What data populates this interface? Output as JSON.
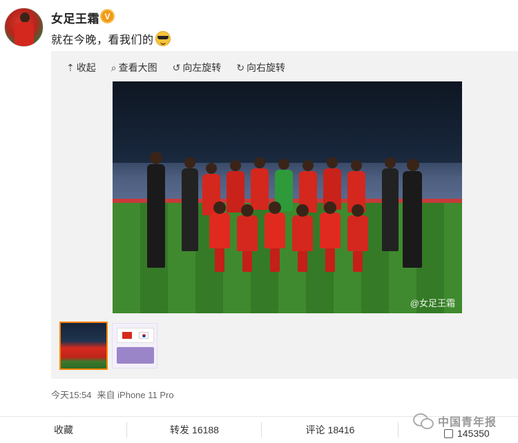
{
  "user": {
    "name": "女足王霜",
    "verified_badge": "V"
  },
  "post": {
    "text": "就在今晚，看我们的"
  },
  "toolbar": {
    "collapse": "收起",
    "view_large": "查看大图",
    "rotate_left": "向左旋转",
    "rotate_right": "向右旋转"
  },
  "photo": {
    "watermark": "@女足王霜"
  },
  "meta": {
    "time": "今天15:54",
    "source": "来自 iPhone 11 Pro"
  },
  "actions": {
    "favorite": "收藏",
    "repost_label": "转发",
    "repost_count": "16188",
    "comment_label": "评论",
    "comment_count": "18416",
    "like_count": "145350"
  },
  "brand": {
    "name": "中国青年报"
  },
  "colors": {
    "accent": "#ff8200",
    "badge": "#f19a1a",
    "jersey_red": "#d4271e"
  }
}
